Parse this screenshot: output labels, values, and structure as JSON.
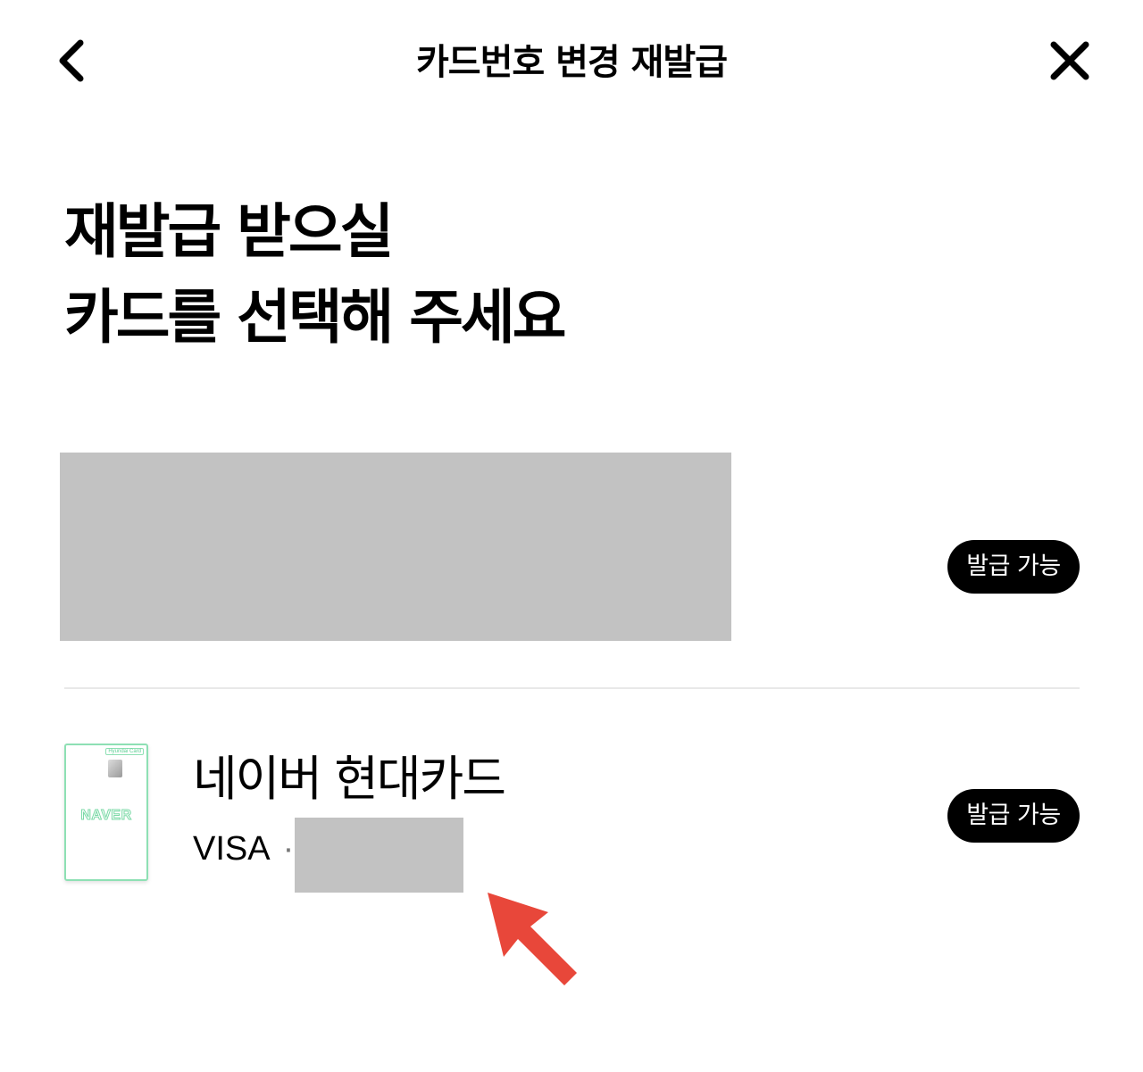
{
  "header": {
    "title": "카드번호 변경 재발급",
    "back_icon": "chevron-left-icon",
    "close_icon": "close-icon"
  },
  "heading": {
    "line1": "재발급 받으실",
    "line2": "카드를 선택해 주세요"
  },
  "cards": [
    {
      "name": "",
      "badge": "발급 가능"
    },
    {
      "name": "네이버 현대카드",
      "network": "VISA",
      "separator": "·",
      "badge": "발급 가능",
      "thumbnail": {
        "brand": "NAVER",
        "issuer": "Hyundai Card"
      }
    }
  ],
  "colors": {
    "badge_bg": "#000000",
    "redaction": "#c2c2c2",
    "card_accent": "#8ee0b4",
    "annotation_arrow": "#e8473a"
  }
}
